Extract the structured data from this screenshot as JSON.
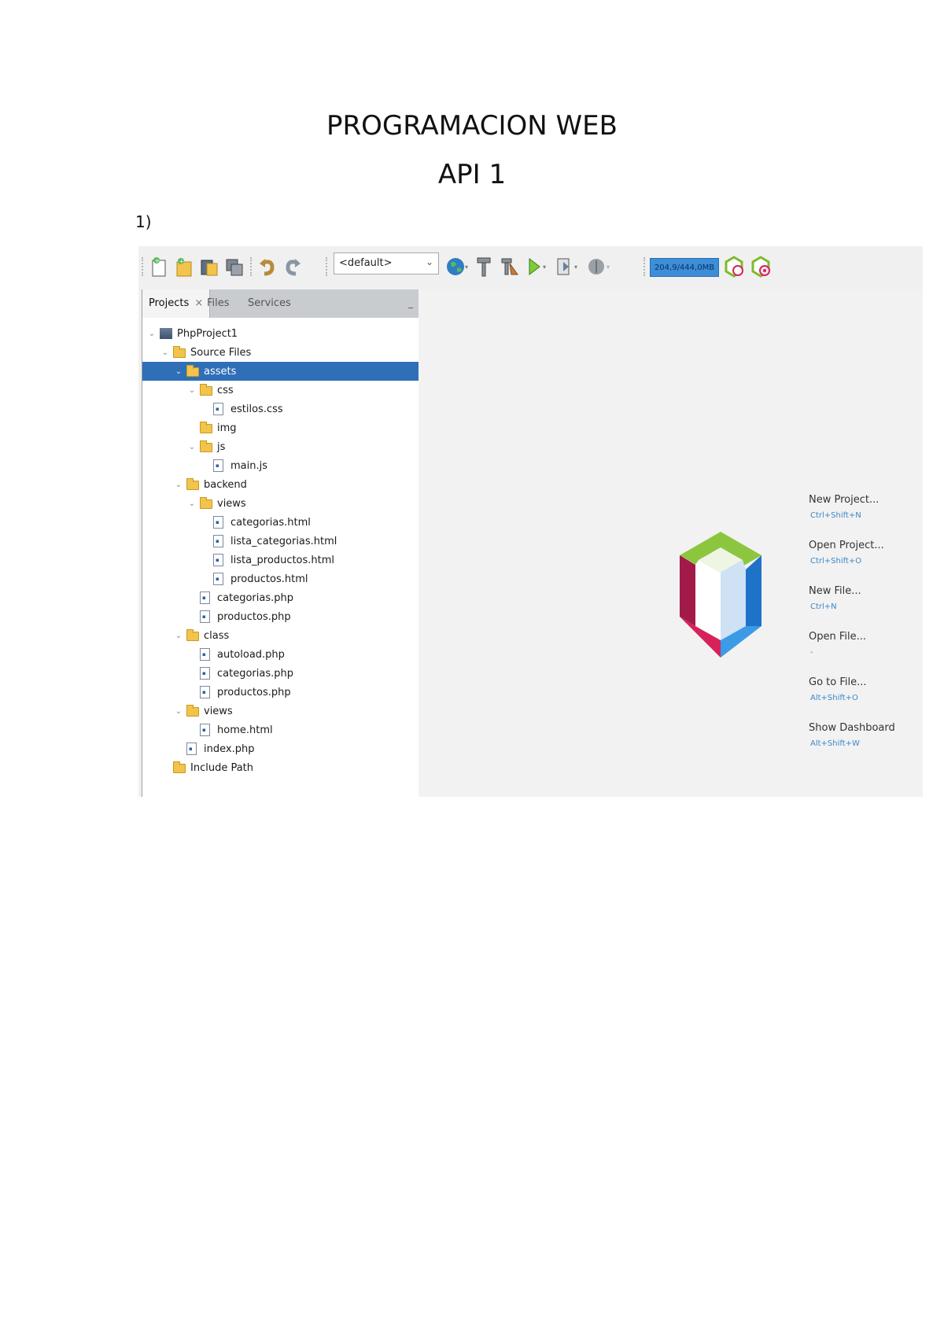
{
  "document": {
    "title": "PROGRAMACION WEB",
    "subtitle": "API 1",
    "item_number": "1)"
  },
  "toolbar": {
    "config_value": "<default>",
    "memory": "204,9/444,0MB",
    "icons": [
      "new-file-icon",
      "new-project-icon",
      "open-project-icon",
      "save-all-icon",
      "undo-icon",
      "redo-icon",
      "globe-icon",
      "build-icon",
      "clean-build-icon",
      "run-icon",
      "debug-icon",
      "profile-icon",
      "gc-icon",
      "gc-alt-icon"
    ]
  },
  "panel": {
    "tabs": [
      "Projects",
      "Files",
      "Services"
    ],
    "active_tab": "Projects",
    "tree": [
      {
        "label": "PhpProject1",
        "depth": 0,
        "type": "project",
        "expanded": true
      },
      {
        "label": "Source Files",
        "depth": 1,
        "type": "folder",
        "expanded": true
      },
      {
        "label": "assets",
        "depth": 2,
        "type": "folder",
        "expanded": true,
        "selected": true
      },
      {
        "label": "css",
        "depth": 3,
        "type": "folder",
        "expanded": true
      },
      {
        "label": "estilos.css",
        "depth": 4,
        "type": "file"
      },
      {
        "label": "img",
        "depth": 3,
        "type": "folder"
      },
      {
        "label": "js",
        "depth": 3,
        "type": "folder",
        "expanded": true
      },
      {
        "label": "main.js",
        "depth": 4,
        "type": "file"
      },
      {
        "label": "backend",
        "depth": 2,
        "type": "folder",
        "expanded": true
      },
      {
        "label": "views",
        "depth": 3,
        "type": "folder",
        "expanded": true
      },
      {
        "label": "categorias.html",
        "depth": 4,
        "type": "file"
      },
      {
        "label": "lista_categorias.html",
        "depth": 4,
        "type": "file"
      },
      {
        "label": "lista_productos.html",
        "depth": 4,
        "type": "file"
      },
      {
        "label": "productos.html",
        "depth": 4,
        "type": "file"
      },
      {
        "label": "categorias.php",
        "depth": 3,
        "type": "file"
      },
      {
        "label": "productos.php",
        "depth": 3,
        "type": "file"
      },
      {
        "label": "class",
        "depth": 2,
        "type": "folder",
        "expanded": true
      },
      {
        "label": "autoload.php",
        "depth": 3,
        "type": "file"
      },
      {
        "label": "categorias.php",
        "depth": 3,
        "type": "file"
      },
      {
        "label": "productos.php",
        "depth": 3,
        "type": "file"
      },
      {
        "label": "views",
        "depth": 2,
        "type": "folder",
        "expanded": true
      },
      {
        "label": "home.html",
        "depth": 3,
        "type": "file"
      },
      {
        "label": "index.php",
        "depth": 2,
        "type": "file"
      },
      {
        "label": "Include Path",
        "depth": 1,
        "type": "folder"
      }
    ]
  },
  "start_page": {
    "links": [
      {
        "label": "New Project...",
        "shortcut": "Ctrl+Shift+N"
      },
      {
        "label": "Open Project...",
        "shortcut": "Ctrl+Shift+O"
      },
      {
        "label": "New File...",
        "shortcut": "Ctrl+N"
      },
      {
        "label": "Open File...",
        "shortcut": "-"
      },
      {
        "label": "Go to File...",
        "shortcut": "Alt+Shift+O"
      },
      {
        "label": "Show Dashboard",
        "shortcut": "Alt+Shift+W"
      }
    ],
    "colors": {
      "green": "#8cc63f",
      "blue": "#1e73c9",
      "red": "#d6225b",
      "light_blue": "#3b9be6",
      "dark_red": "#a11a4a"
    }
  }
}
